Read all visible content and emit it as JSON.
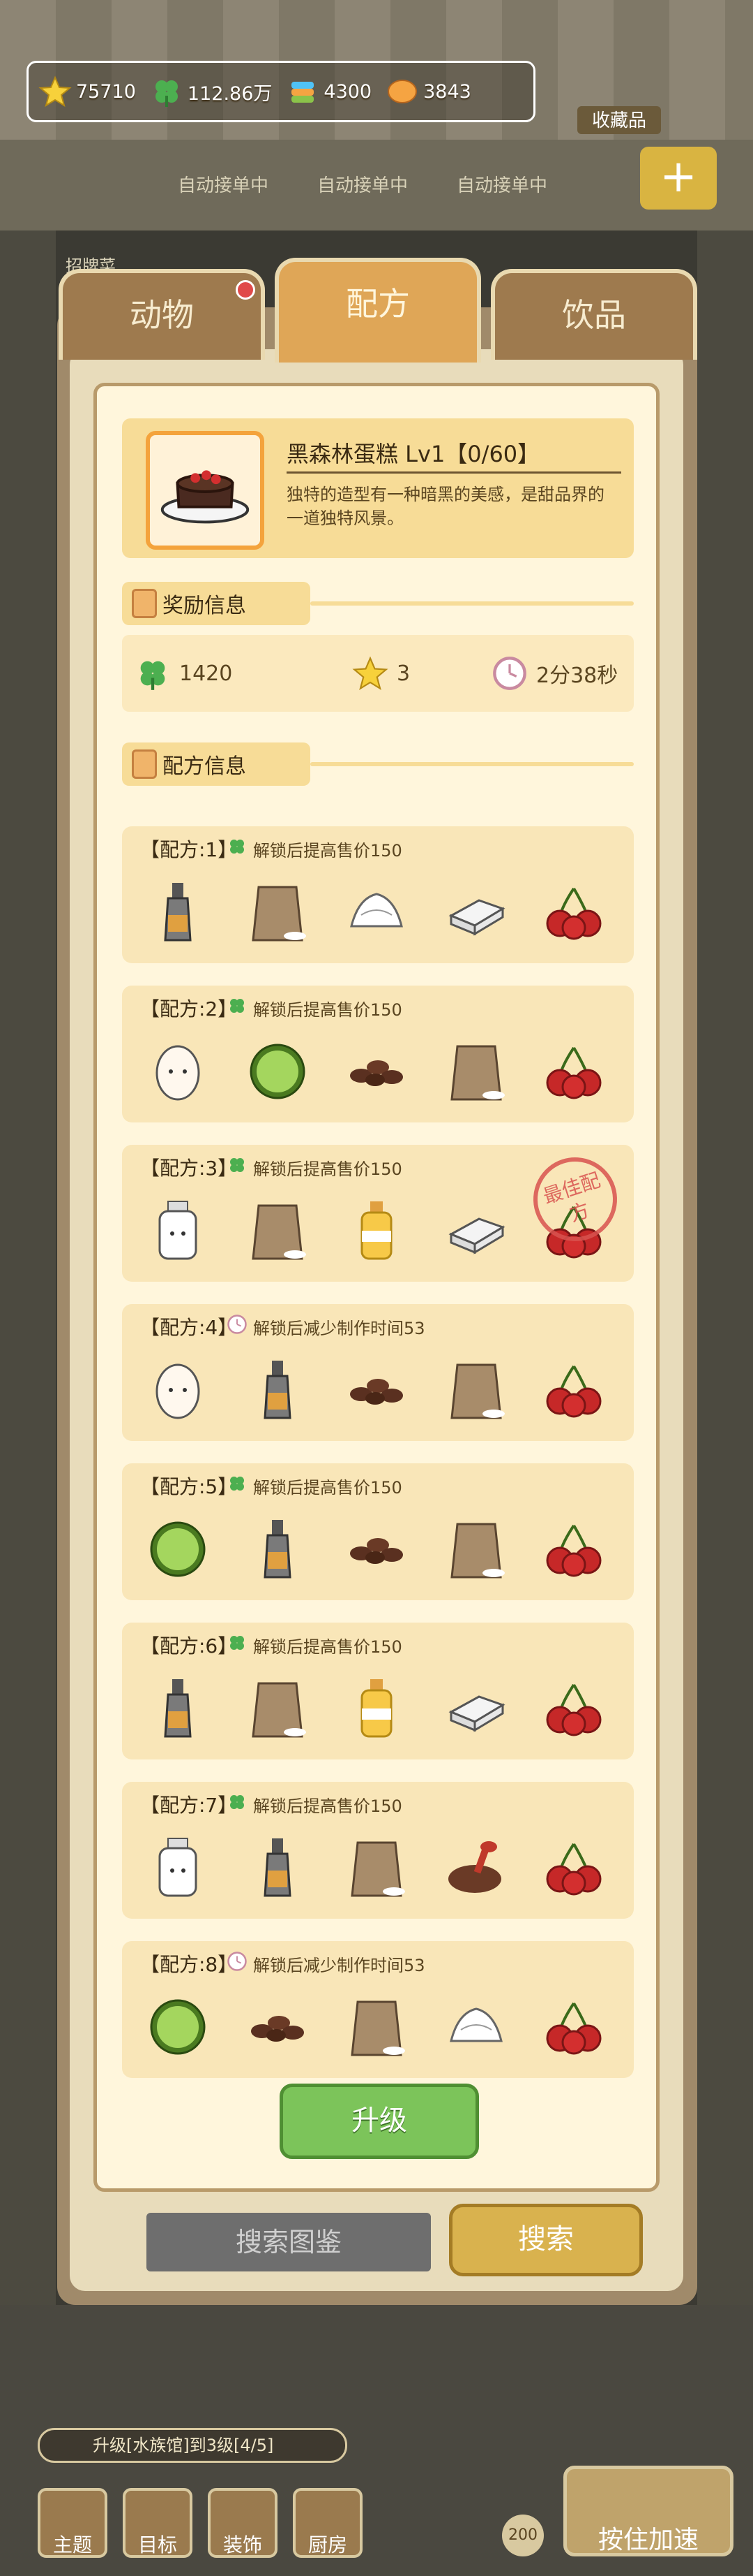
{
  "currency": {
    "stars": "75710",
    "clover": "112.86万",
    "gems": "4300",
    "coins": "3843"
  },
  "background": {
    "collection_label": "收藏品",
    "order_labels": [
      "自动接单中",
      "自动接单中",
      "自动接单中"
    ],
    "sign_label": "招牌菜"
  },
  "tabs": [
    {
      "label": "动物"
    },
    {
      "label": "配方"
    },
    {
      "label": "饮品"
    }
  ],
  "dish": {
    "name": "黑森林蛋糕 Lv1【0/60】",
    "description": "独特的造型有一种暗黑的美感，是甜品界的一道独特风景。"
  },
  "reward_section": {
    "title": "奖励信息",
    "clover": "1420",
    "stars": "3",
    "time": "2分38秒"
  },
  "recipe_section": {
    "title": "配方信息"
  },
  "recipes": [
    {
      "title": "【配方:1】",
      "note": "解锁后提高售价150",
      "note_icon": "clover-icon",
      "ingredients": [
        "sauce-bottle",
        "flour-bag",
        "whipped-cream",
        "butter",
        "cherries"
      ],
      "best": false
    },
    {
      "title": "【配方:2】",
      "note": "解锁后提高售价150",
      "note_icon": "clover-icon",
      "ingredients": [
        "egg",
        "lime",
        "cocoa-beans",
        "flour-bag",
        "cherries"
      ],
      "best": false
    },
    {
      "title": "【配方:3】",
      "note": "解锁后提高售价150",
      "note_icon": "clover-icon",
      "ingredients": [
        "milk",
        "flour-bag",
        "oil-bottle",
        "butter",
        "cherries"
      ],
      "best": true,
      "best_label": "最佳配方"
    },
    {
      "title": "【配方:4】",
      "note": "解锁后减少制作时间53",
      "note_icon": "clock-icon",
      "ingredients": [
        "egg",
        "sauce-bottle",
        "cocoa-beans",
        "flour-bag",
        "cherries"
      ],
      "best": false
    },
    {
      "title": "【配方:5】",
      "note": "解锁后提高售价150",
      "note_icon": "clover-icon",
      "ingredients": [
        "lime",
        "sauce-bottle",
        "cocoa-beans",
        "flour-bag",
        "cherries"
      ],
      "best": false
    },
    {
      "title": "【配方:6】",
      "note": "解锁后提高售价150",
      "note_icon": "clover-icon",
      "ingredients": [
        "sauce-bottle",
        "flour-bag",
        "oil-bottle",
        "butter",
        "cherries"
      ],
      "best": false
    },
    {
      "title": "【配方:7】",
      "note": "解锁后提高售价150",
      "note_icon": "clover-icon",
      "ingredients": [
        "milk",
        "sauce-bottle",
        "flour-bag",
        "cocoa-powder",
        "cherries"
      ],
      "best": false
    },
    {
      "title": "【配方:8】",
      "note": "解锁后减少制作时间53",
      "note_icon": "clock-icon",
      "ingredients": [
        "lime",
        "cocoa-beans",
        "flour-bag",
        "whipped-cream",
        "cherries"
      ],
      "best": false
    }
  ],
  "upgrade_label": "升级",
  "search": {
    "placeholder": "搜索图鉴",
    "button_label": "搜索"
  },
  "bottom": {
    "quest_text": "升级[水族馆]到3级[4/5]",
    "nav": [
      "主题",
      "目标",
      "装饰",
      "厨房"
    ],
    "speed_label": "按住加速",
    "speed_count": "200"
  },
  "colors": {
    "accent_orange": "#dfa657",
    "panel_cream": "#fff6dc",
    "card_yellow": "#f7dc97",
    "upgrade_green": "#7cc45a",
    "stamp_red": "#d9534f"
  }
}
